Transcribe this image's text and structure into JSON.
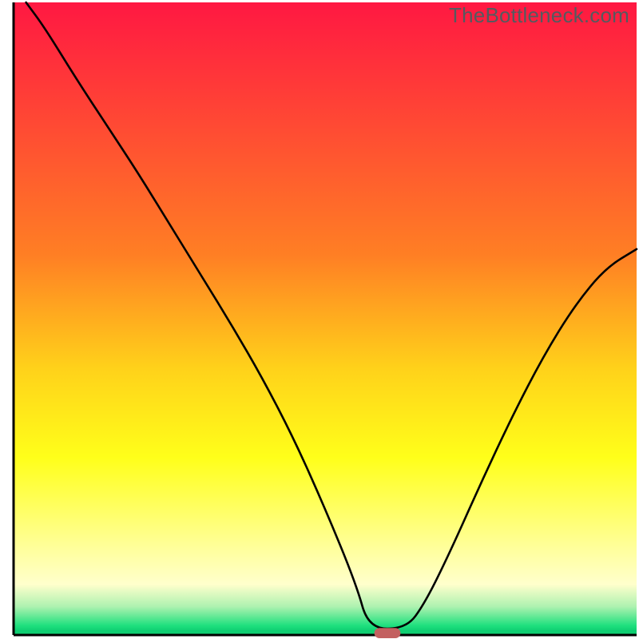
{
  "watermark": "TheBottleneck.com",
  "chart_data": {
    "type": "line",
    "title": "",
    "xlabel": "",
    "ylabel": "",
    "xlim": [
      0,
      100
    ],
    "ylim": [
      0,
      100
    ],
    "grid": false,
    "background_gradient": {
      "direction": "vertical_top_to_bottom",
      "stops": [
        {
          "pos": 0.0,
          "color": "#ff1842"
        },
        {
          "pos": 0.2,
          "color": "#ff4b33"
        },
        {
          "pos": 0.4,
          "color": "#ff7f24"
        },
        {
          "pos": 0.58,
          "color": "#ffd21a"
        },
        {
          "pos": 0.72,
          "color": "#ffff1a"
        },
        {
          "pos": 0.86,
          "color": "#ffff99"
        },
        {
          "pos": 0.92,
          "color": "#ffffcc"
        },
        {
          "pos": 0.955,
          "color": "#aef2b0"
        },
        {
          "pos": 0.985,
          "color": "#1fe07e"
        },
        {
          "pos": 0.993,
          "color": "#0fcf72"
        },
        {
          "pos": 1.0,
          "color": "#0fcf72"
        }
      ]
    },
    "series": [
      {
        "name": "bottleneck-curve",
        "stroke": "#000000",
        "stroke_width": 2.6,
        "x": [
          2,
          5,
          10,
          15,
          20,
          25,
          30,
          35,
          40,
          45,
          50,
          55,
          57,
          63,
          66,
          70,
          75,
          80,
          85,
          90,
          95,
          100
        ],
        "y": [
          100,
          96,
          88,
          80.5,
          73,
          65,
          57,
          49,
          40.5,
          31,
          20,
          8,
          1,
          1,
          5,
          13,
          24,
          34.5,
          44,
          52,
          58,
          61
        ]
      }
    ],
    "markers": [
      {
        "name": "optimum-marker",
        "shape": "rounded-rect",
        "x": 60,
        "y": 0.3,
        "width_pct": 4.2,
        "height_pct": 1.6,
        "fill": "#c36060"
      }
    ]
  }
}
